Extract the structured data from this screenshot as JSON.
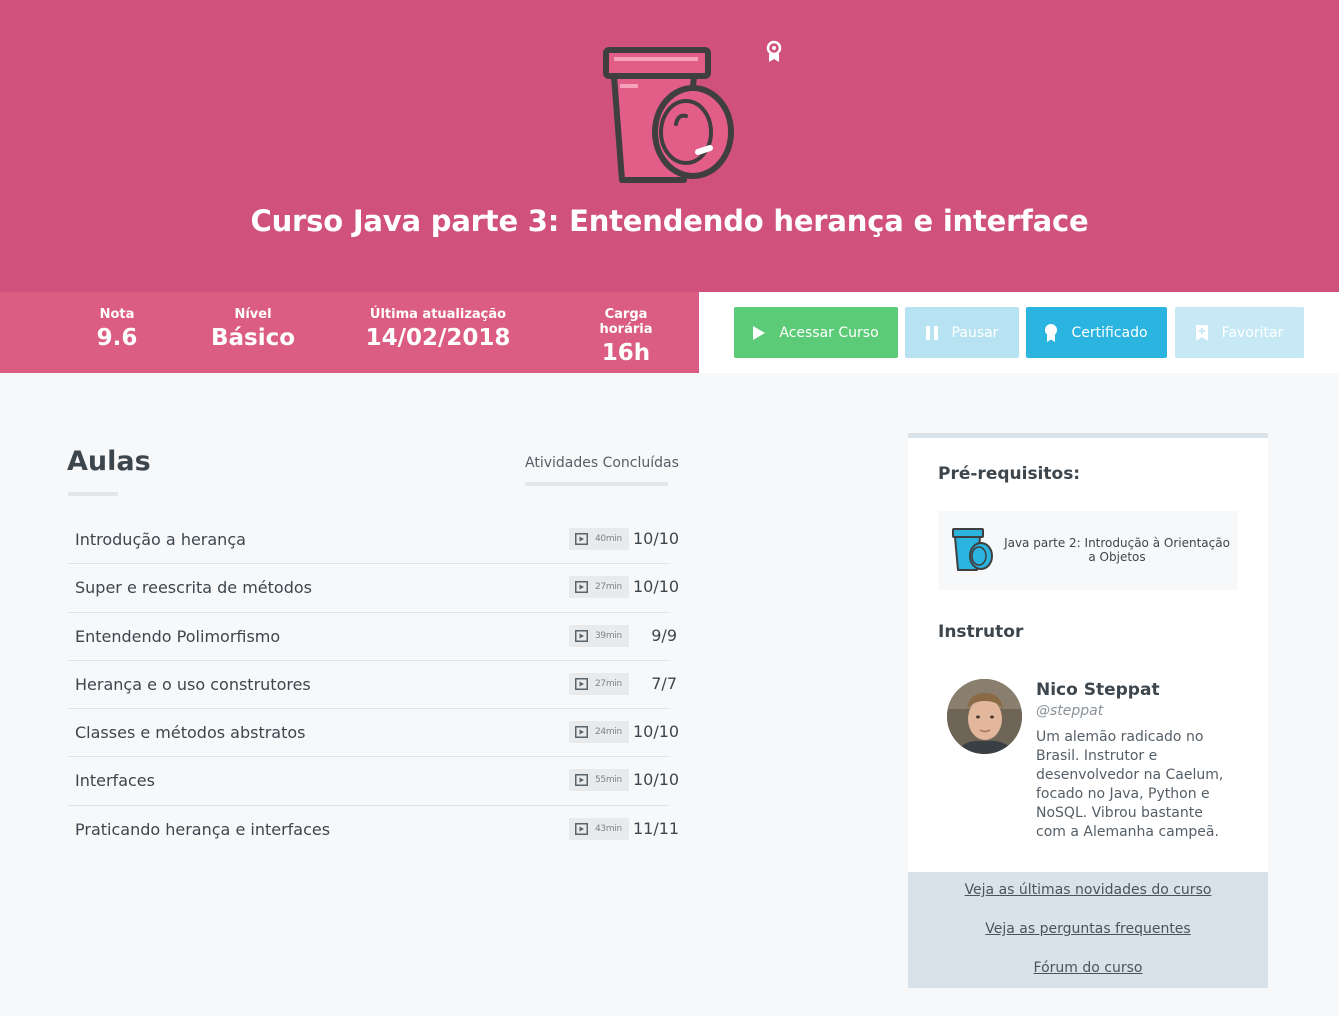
{
  "colors": {
    "hero_bg": "#d0517b",
    "stats_bg": "#dc5d83",
    "access_button": "#5ccb77",
    "pause_button": "#b7e2f1",
    "certificate_button": "#2cb4e1",
    "favorite_button": "#c6e9f5",
    "course_icon_pink": "#e25d87",
    "prereq_icon_cyan": "#2cb4e1"
  },
  "hero": {
    "title": "Curso Java parte 3: Entendendo herança e interface",
    "icon": "coffee-cup-icon",
    "badge_icon": "ribbon-icon"
  },
  "stats": [
    {
      "label": "Nota",
      "value": "9.6"
    },
    {
      "label": "Nível",
      "value": "Básico"
    },
    {
      "label": "Última atualização",
      "value": "14/02/2018"
    },
    {
      "label": "Carga horária",
      "value": "16h"
    }
  ],
  "actions": {
    "access": {
      "label": "Acessar Curso",
      "icon": "play-icon"
    },
    "pause": {
      "label": "Pausar",
      "icon": "pause-icon"
    },
    "certificate": {
      "label": "Certificado",
      "icon": "medal-icon"
    },
    "favorite": {
      "label": "Favoritar",
      "icon": "bookmark-icon"
    }
  },
  "lessons": {
    "title": "Aulas",
    "activities_label": "Atividades Concluídas",
    "items": [
      {
        "name": "Introdução a herança",
        "duration": "40min",
        "progress": "10/10"
      },
      {
        "name": "Super e reescrita de métodos",
        "duration": "27min",
        "progress": "10/10"
      },
      {
        "name": "Entendendo Polimorfismo",
        "duration": "39min",
        "progress": "9/9"
      },
      {
        "name": "Herança e o uso construtores",
        "duration": "27min",
        "progress": "7/7"
      },
      {
        "name": "Classes e métodos abstratos",
        "duration": "24min",
        "progress": "10/10"
      },
      {
        "name": "Interfaces",
        "duration": "55min",
        "progress": "10/10"
      },
      {
        "name": "Praticando herança e interfaces",
        "duration": "43min",
        "progress": "11/11"
      }
    ]
  },
  "sidebar": {
    "prerequisites_title": "Pré-requisitos:",
    "prerequisite_course": "Java parte 2: Introdução à Orientação a Objetos",
    "instructor_title": "Instrutor",
    "instructor": {
      "name": "Nico Steppat",
      "handle": "@steppat",
      "bio": "Um alemão radicado no Brasil. Instrutor e desenvolvedor na Caelum, focado no Java, Python e NoSQL. Vibrou bastante com a Alemanha campeã."
    },
    "links": [
      "Veja as últimas novidades do curso",
      "Veja as perguntas frequentes",
      "Fórum do curso"
    ]
  }
}
